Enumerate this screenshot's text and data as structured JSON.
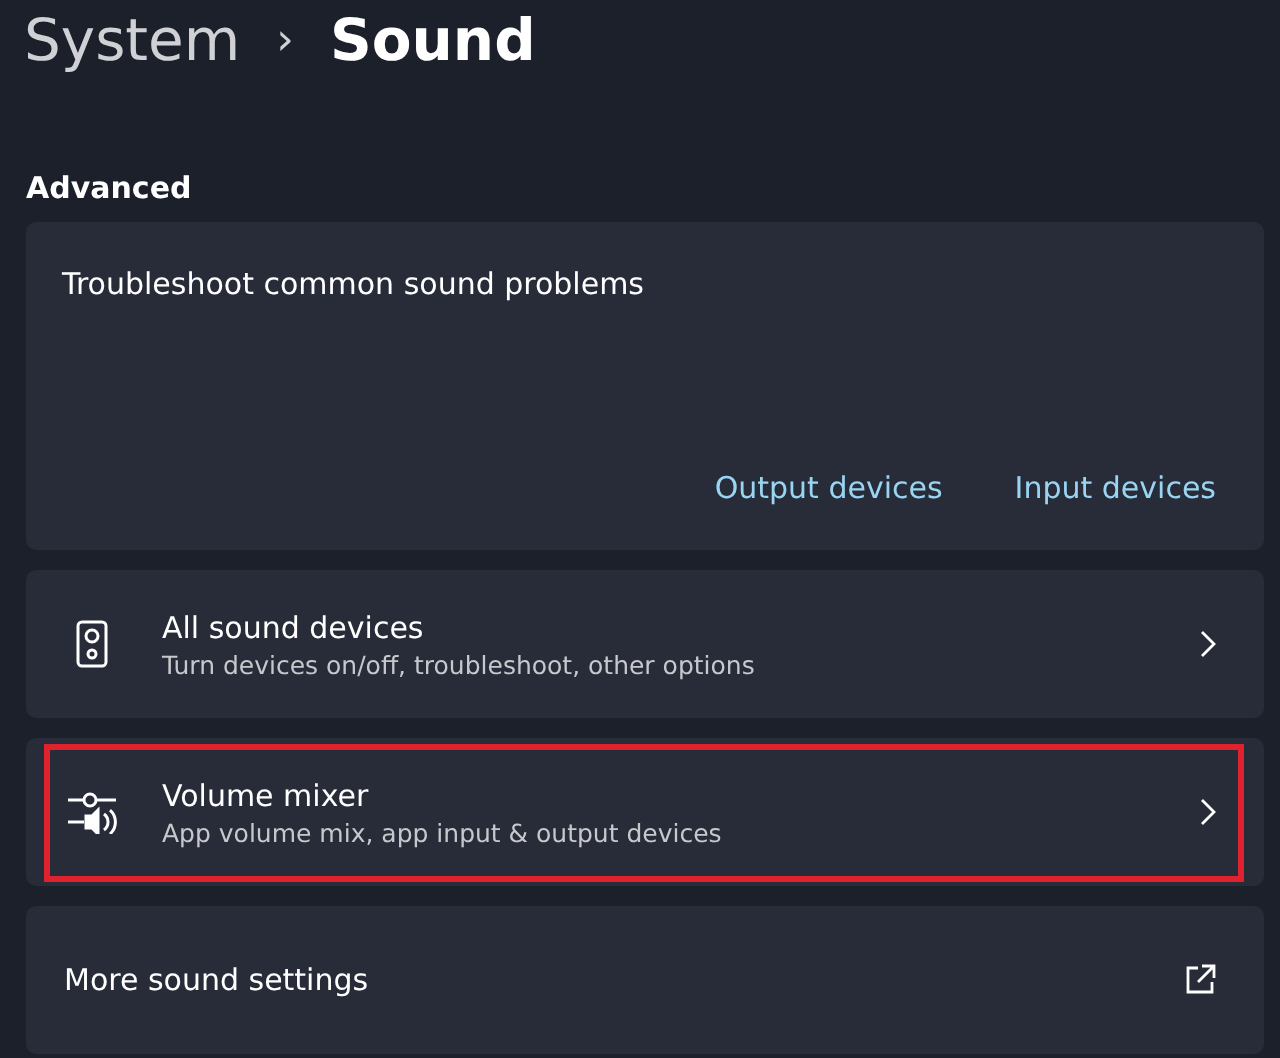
{
  "breadcrumb": {
    "parent": "System",
    "separator": "›",
    "current": "Sound"
  },
  "section": "Advanced",
  "troubleshoot": {
    "title": "Troubleshoot common sound problems",
    "links": [
      "Output devices",
      "Input devices"
    ]
  },
  "items": [
    {
      "kind": "navigate",
      "title": "All sound devices",
      "subtitle": "Turn devices on/off, troubleshoot, other options",
      "highlighted": false
    },
    {
      "kind": "navigate",
      "title": "Volume mixer",
      "subtitle": "App volume mix, app input & output devices",
      "highlighted": true
    },
    {
      "kind": "external",
      "title": "More sound settings",
      "highlighted": false
    }
  ]
}
